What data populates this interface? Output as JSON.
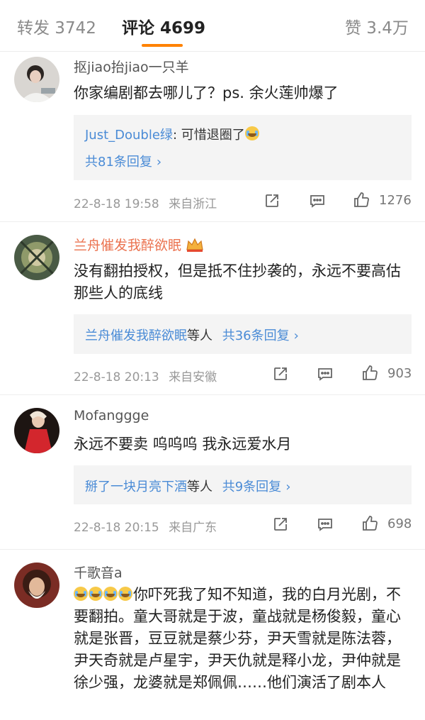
{
  "tabs": {
    "repost": "转发 3742",
    "comment": "评论 4699",
    "like": "赞 3.4万"
  },
  "comments": [
    {
      "user": "抠jiao抬jiao一只羊",
      "text": "你家编剧都去哪儿了？ps. 余火莲帅爆了",
      "reply_user": "Just_Double绿",
      "reply_text": ": 可惜退圈了",
      "reply_total": "共81条回复",
      "time": "22-8-18 19:58",
      "source": "来自浙江",
      "likes": "1276"
    },
    {
      "user": "兰舟催发我醉欲眠",
      "text": "没有翻拍授权，但是抵不住抄袭的，永远不要高估那些人的底线",
      "reply_names": "兰舟催发我醉欲眠",
      "reply_etc": "等人",
      "reply_total": "共36条回复",
      "time": "22-8-18 20:13",
      "source": "来自安徽",
      "likes": "903"
    },
    {
      "user": "Mofanggge",
      "text": "永远不要卖 呜呜呜 我永远爱水月",
      "reply_names": "掰了一块月亮下酒",
      "reply_etc": "等人",
      "reply_total": "共9条回复",
      "time": "22-8-18 20:15",
      "source": "来自广东",
      "likes": "698"
    },
    {
      "user": "千歌音a",
      "text": "你吓死我了知不知道，我的白月光剧，不要翻拍。童大哥就是于波，童战就是杨俊毅，童心就是张晋，豆豆就是蔡少芬，尹天雪就是陈法蓉，尹天奇就是卢星宇，尹天仇就是释小龙，尹仲就是徐少强，龙婆就是郑佩佩……他们演活了剧本人"
    }
  ],
  "icons": {
    "share": "share-icon",
    "comment": "comment-icon",
    "like": "thumbs-up-icon",
    "chevron": "chevron-right-icon",
    "crown": "crown-badge-icon",
    "emoji": "crying-emoji-icon"
  },
  "colors": {
    "accent": "#ff8200",
    "link": "#4a8bd6",
    "vip_name": "#eb7350"
  }
}
